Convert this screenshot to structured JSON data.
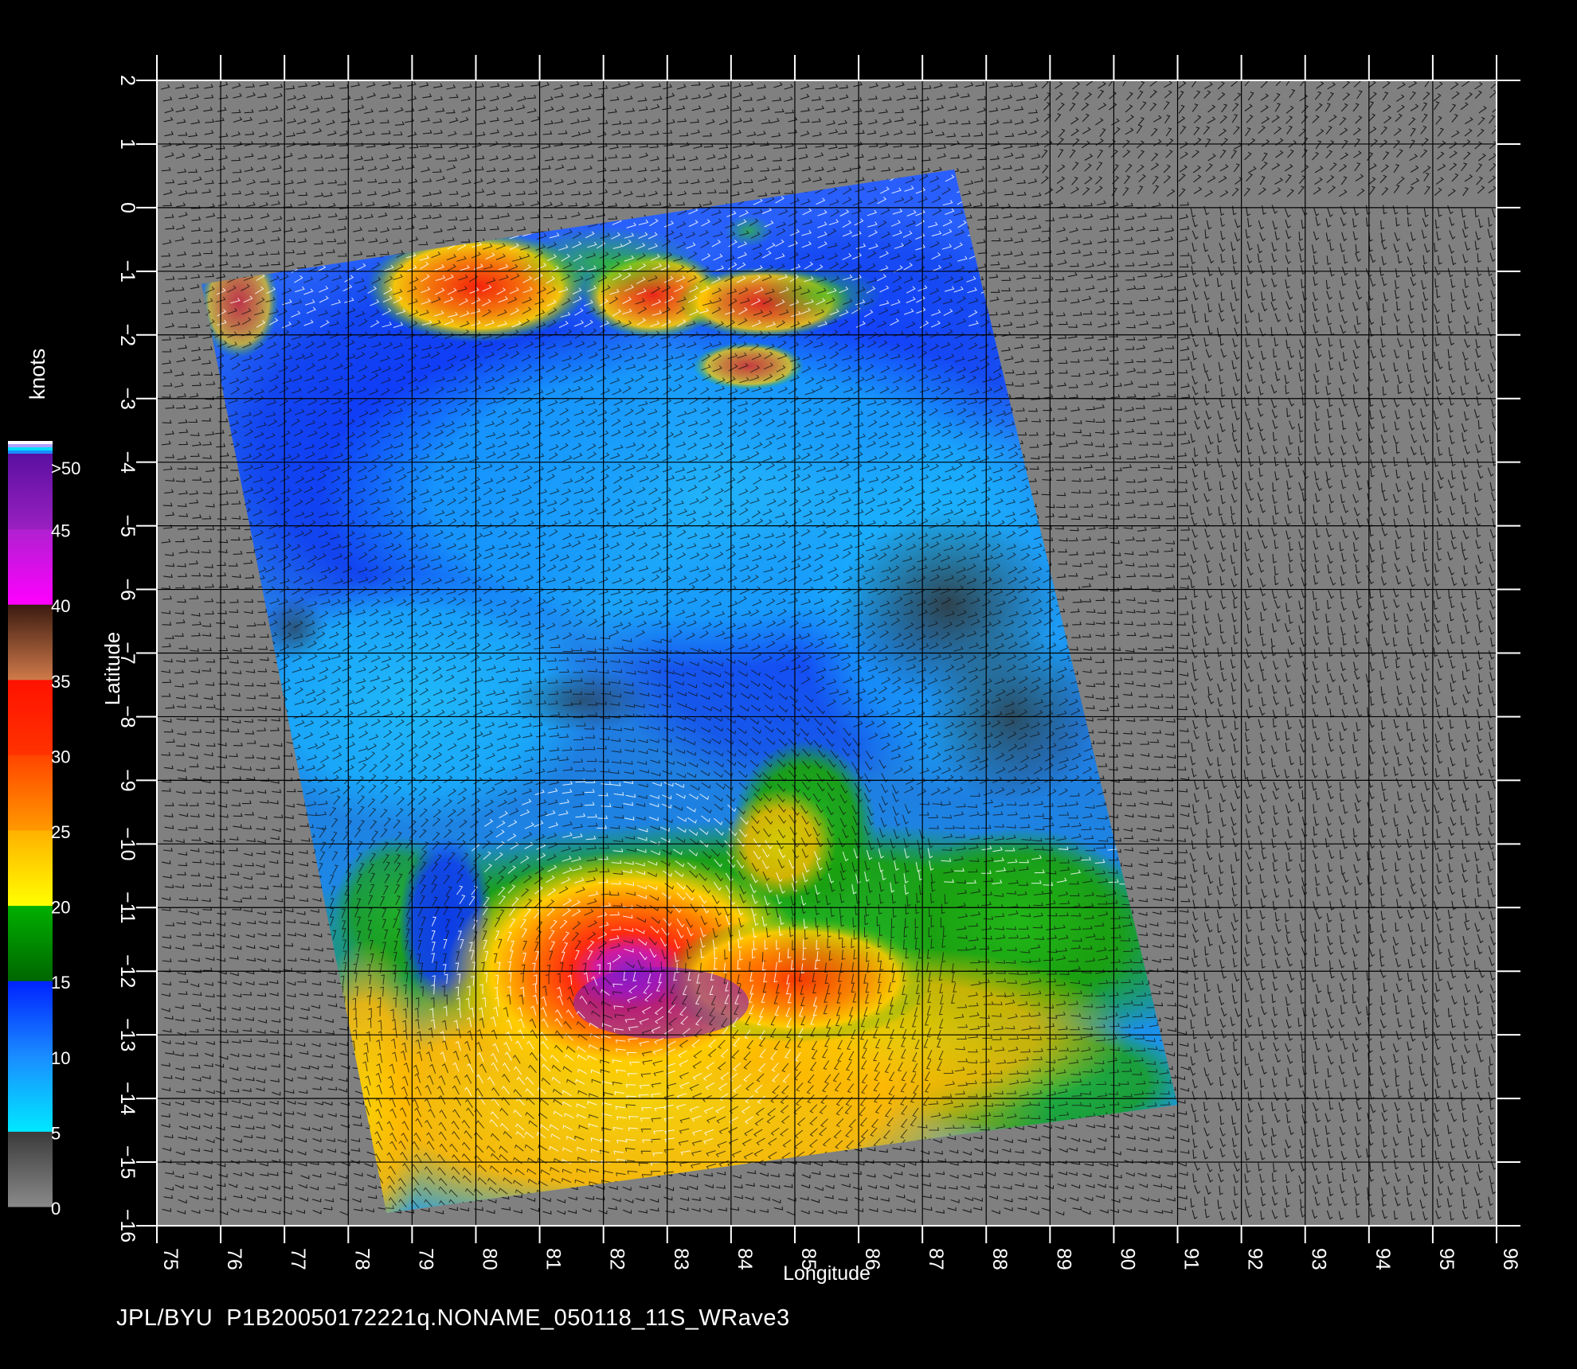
{
  "footer_text": "JPL/BYU  P1B20050172221q.NONAME_050118_11S_WRave3",
  "map": {
    "xlabel": "Longitude",
    "ylabel": "Latitude",
    "lon_range": [
      75,
      96
    ],
    "lat_range": [
      -16,
      2
    ],
    "lon_ticks": [
      "75",
      "76",
      "77",
      "78",
      "79",
      "80",
      "81",
      "82",
      "83",
      "84",
      "85",
      "86",
      "87",
      "88",
      "89",
      "90",
      "91",
      "92",
      "93",
      "94",
      "95",
      "96"
    ],
    "lat_ticks": [
      "2",
      "1",
      "0",
      "−1",
      "−2",
      "−3",
      "−4",
      "−5",
      "−6",
      "−7",
      "−8",
      "−9",
      "−10",
      "−11",
      "−12",
      "−13",
      "−14",
      "−15",
      "−16"
    ],
    "background_color": "#808080",
    "grid_color": "#000000",
    "swath_corners_lonlat": [
      [
        75.7,
        -1.2
      ],
      [
        87.5,
        0.6
      ],
      [
        91.0,
        -14.1
      ],
      [
        78.6,
        -15.8
      ]
    ]
  },
  "legend": {
    "title": "knots",
    "labels": [
      ">50",
      "45",
      "40",
      "35",
      "30",
      "25",
      "20",
      "15",
      "10",
      "5",
      "0"
    ],
    "bands": [
      {
        "from": 0,
        "to": 5,
        "top": "#3a3a3a",
        "bottom": "#8a8a8a"
      },
      {
        "from": 5,
        "to": 10,
        "top": "#1a8cff",
        "bottom": "#00e8ff"
      },
      {
        "from": 10,
        "to": 15,
        "top": "#0022ff",
        "bottom": "#1a8cff"
      },
      {
        "from": 15,
        "to": 20,
        "top": "#00b000",
        "bottom": "#006600"
      },
      {
        "from": 20,
        "to": 25,
        "top": "#ffb000",
        "bottom": "#ffff00"
      },
      {
        "from": 25,
        "to": 30,
        "top": "#ff4400",
        "bottom": "#ff9900"
      },
      {
        "from": 30,
        "to": 35,
        "top": "#ff1100",
        "bottom": "#ff3300"
      },
      {
        "from": 35,
        "to": 40,
        "top": "#3a1a10",
        "bottom": "#d07a4a"
      },
      {
        "from": 40,
        "to": 45,
        "top": "#b020d0",
        "bottom": "#ff00ff"
      },
      {
        "from": 45,
        "to": 50,
        "top": "#5a10a0",
        "bottom": "#9a20c0"
      }
    ],
    "top_stripes": [
      "#ffffff",
      "#b0a0ff",
      "#00e0ff",
      "#1a8cff"
    ]
  }
}
